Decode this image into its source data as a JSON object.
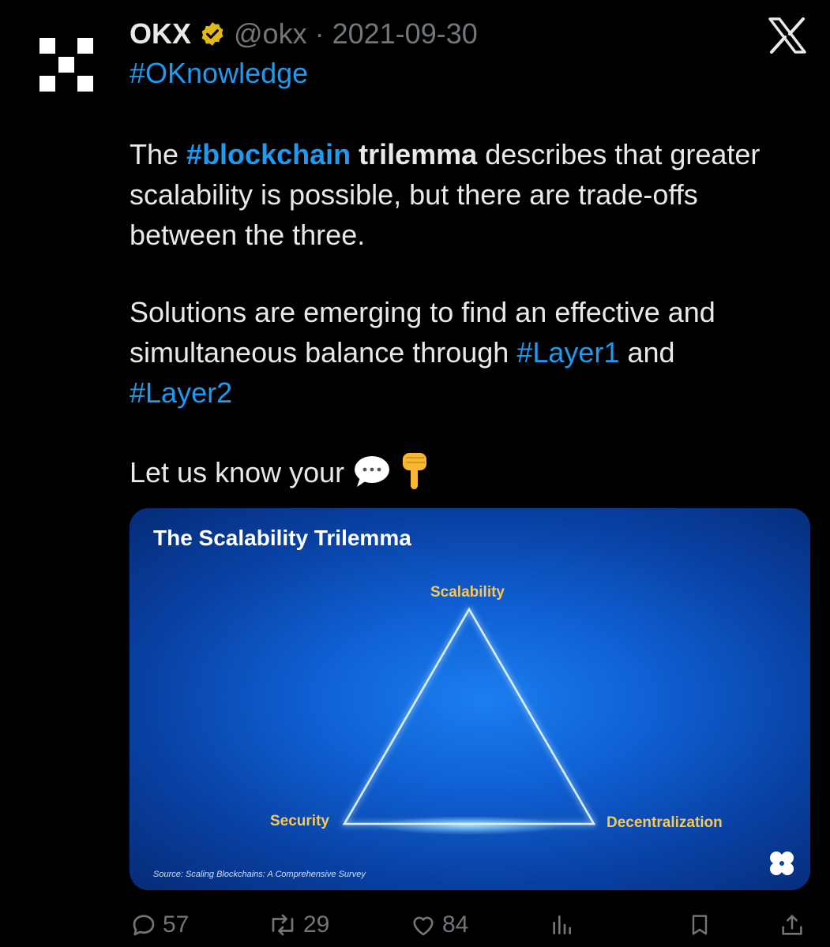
{
  "tweet": {
    "author_name": "OKX",
    "handle": "@okx",
    "separator": "·",
    "date": "2021-09-30",
    "hashtag_line": "#OKnowledge",
    "para1": {
      "t1": "The ",
      "link": "#blockchain",
      "t2": " ",
      "bold": "trilemma",
      "t3": " describes that greater scalability is possible, but there are trade-offs between the three."
    },
    "para2": {
      "t1": "Solutions are emerging to find an effective and simultaneous balance through ",
      "link1": "#Layer1",
      "t2": " and ",
      "link2": "#Layer2"
    },
    "para3": {
      "t1": "Let us know your "
    }
  },
  "media": {
    "title": "The Scalability Trilemma",
    "vertex_top": "Scalability",
    "vertex_left": "Security",
    "vertex_right": "Decentralization",
    "source": "Source: Scaling Blockchains: A Comprehensive Survey"
  },
  "actions": {
    "replies": "57",
    "reposts": "29",
    "likes": "84"
  },
  "colors": {
    "background": "#000000",
    "text": "#e7e9ea",
    "link": "#1d9bf0",
    "muted": "#71767b",
    "verified_gold": "#e2b719",
    "triangle_glow": "#bfe6ff",
    "label_yellow": "#f5c85a"
  },
  "icons": [
    "okx-logo-icon",
    "verified-badge-icon",
    "x-logo-icon",
    "speech-bubble-emoji-icon",
    "pointing-down-emoji-icon",
    "reply-icon",
    "repost-icon",
    "like-icon",
    "views-icon",
    "bookmark-icon",
    "share-icon",
    "okx-small-logo-icon"
  ]
}
